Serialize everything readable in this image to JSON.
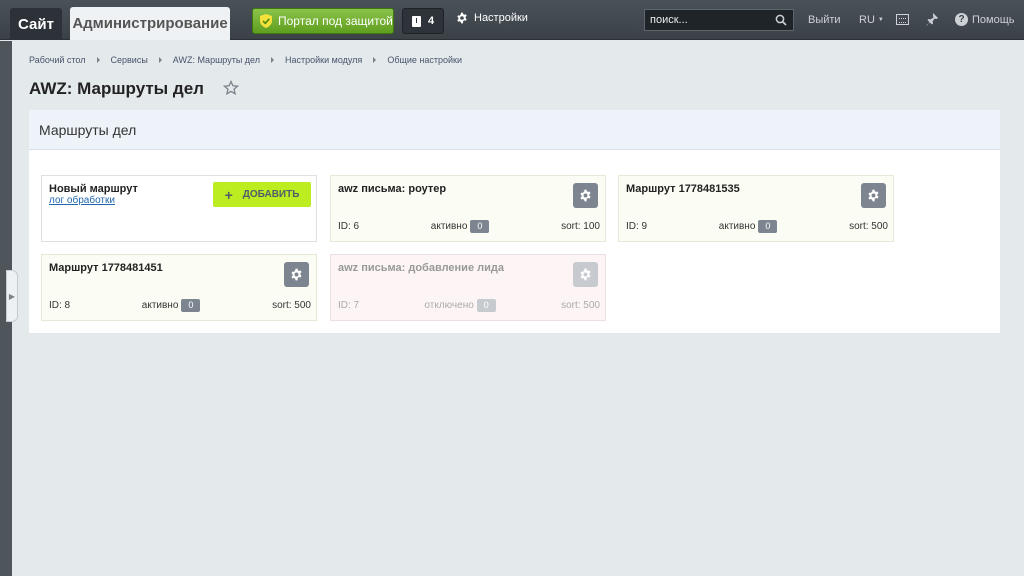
{
  "topbar": {
    "site_tab": "Сайт",
    "admin_tab": "Администрирование",
    "security_button": "Портал под защитой",
    "notifications_count": "4",
    "settings_label": "Настройки",
    "search_placeholder": "поиск...",
    "logout_label": "Выйти",
    "language_label": "RU",
    "help_label": "Помощь"
  },
  "breadcrumbs": [
    "Рабочий стол",
    "Сервисы",
    "AWZ: Маршруты дел",
    "Настройки модуля",
    "Общие настройки"
  ],
  "page": {
    "title": "AWZ: Маршруты дел"
  },
  "panel": {
    "title": "Маршруты дел",
    "new_route": {
      "title": "Новый маршрут",
      "log_link": "лог обработки",
      "add_button": "ДОБАВИТЬ"
    },
    "routes": [
      {
        "title": "awz письма: роутер",
        "id_text": "ID: 6",
        "status": "активно",
        "count": "0",
        "sort_text": "sort: 100"
      },
      {
        "title": "Маршрут 1778481535",
        "id_text": "ID: 9",
        "status": "активно",
        "count": "0",
        "sort_text": "sort: 500"
      },
      {
        "title": "Маршрут 1778481451",
        "id_text": "ID: 8",
        "status": "активно",
        "count": "0",
        "sort_text": "sort: 500"
      },
      {
        "title": "awz письма: добавление лида",
        "id_text": "ID: 7",
        "status": "отключено",
        "count": "0",
        "sort_text": "sort: 500"
      }
    ]
  },
  "colors": {
    "accent_green": "#bbed21",
    "security_green": "#6aab27",
    "topbar": "#3d444a",
    "page_bg": "#e4e9ec"
  }
}
